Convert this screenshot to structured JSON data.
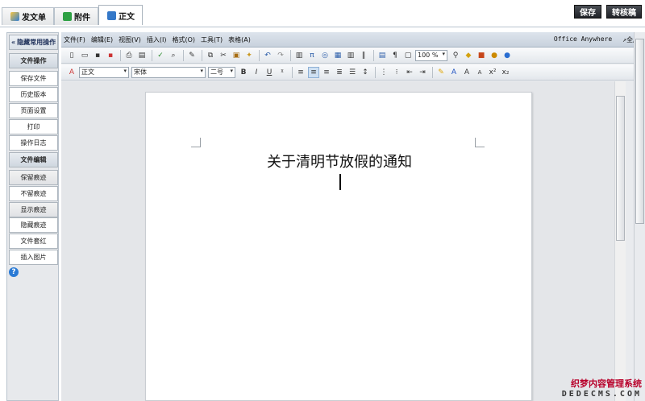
{
  "tabs": [
    {
      "label": "发文单",
      "icon": "form-icon"
    },
    {
      "label": "附件",
      "icon": "attachment-icon"
    },
    {
      "label": "正文",
      "icon": "document-icon"
    }
  ],
  "top_actions": {
    "save": "保存",
    "convert": "转核稿"
  },
  "left_panel": {
    "hide_label": "隐藏常用操作",
    "section_file": "文件操作",
    "file_items": [
      "保存文件",
      "历史版本",
      "页面设置",
      "打印",
      "操作日志"
    ],
    "section_edit": "文件编辑",
    "edit_items": [
      "保留痕迹",
      "不留痕迹",
      "显示痕迹",
      "隐藏痕迹",
      "文件套红",
      "插入图片"
    ]
  },
  "menubar": {
    "items": [
      "文件(F)",
      "编辑(E)",
      "视图(V)",
      "插入(I)",
      "格式(O)",
      "工具(T)",
      "表格(A)"
    ],
    "brand": "Office Anywhere",
    "fullscreen": "↗全屏"
  },
  "toolbar": {
    "zoom": "100 %",
    "style": "正文",
    "font": "宋体",
    "size": "二号"
  },
  "document": {
    "title": "关于清明节放假的通知"
  },
  "watermark": {
    "line1": "织梦内容管理系统",
    "line2": "DEDECMS.COM"
  }
}
